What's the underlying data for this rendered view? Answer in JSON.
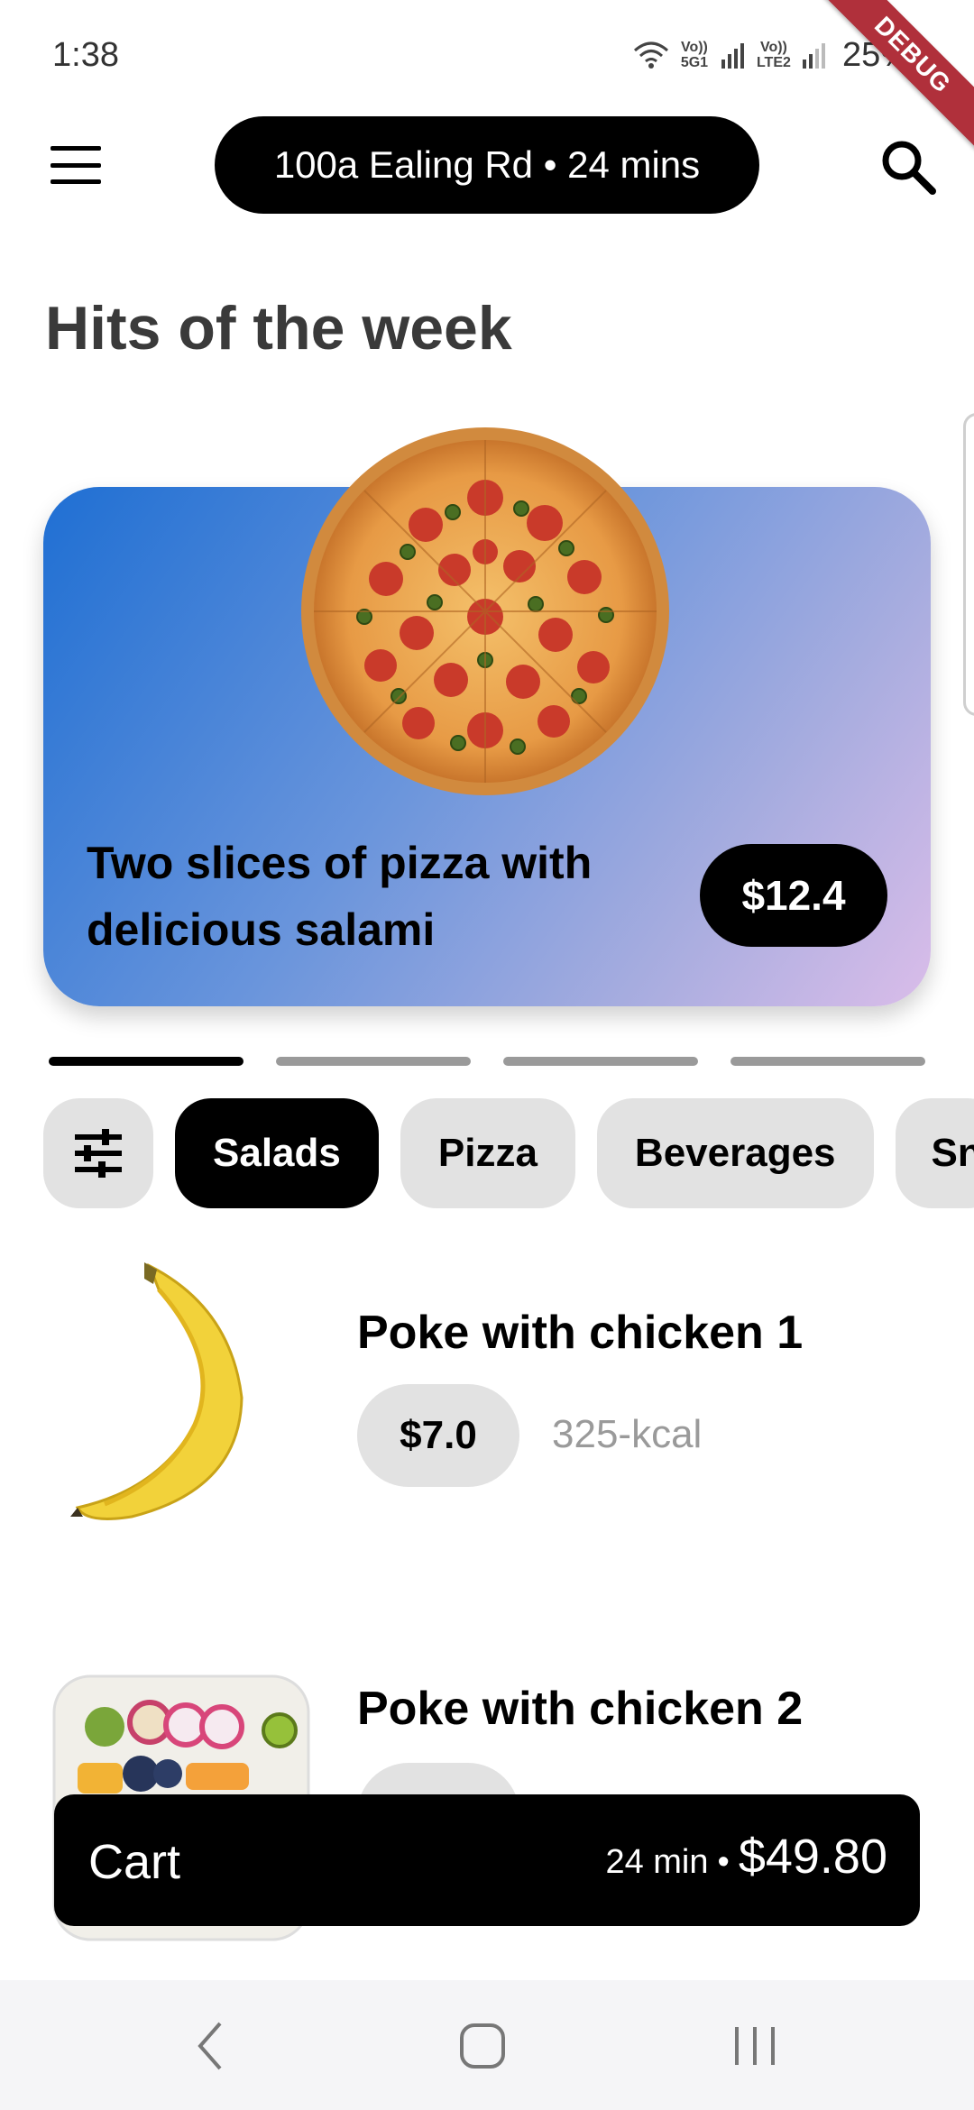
{
  "status_bar": {
    "time": "1:38",
    "signal_1_label": "Vo)) 5G1",
    "signal_2_label": "Vo)) LTE2",
    "battery": "25%",
    "debug_banner": "DEBUG"
  },
  "app_bar": {
    "location_label": "100a Ealing Rd • 24 mins",
    "menu_icon": "menu-icon",
    "search_icon": "search-icon"
  },
  "section_title": "Hits of the week",
  "hero": {
    "title": "Two slices of pizza with delicious salami",
    "price": "$12.4",
    "image": "pizza",
    "gradient_colors": [
      "#1f6fd3",
      "#6a95dc",
      "#a6acdf",
      "#dabde9"
    ]
  },
  "carousel": {
    "page_count": 4,
    "active_index": 0
  },
  "categories": {
    "filter_icon": "filter-sliders-icon",
    "items": [
      {
        "label": "Salads",
        "active": true
      },
      {
        "label": "Pizza",
        "active": false
      },
      {
        "label": "Beverages",
        "active": false
      },
      {
        "label": "Sn",
        "active": false
      }
    ]
  },
  "products": [
    {
      "name": "Poke with chicken 1",
      "price": "$7.0",
      "kcal": "325-kcal",
      "image": "banana"
    },
    {
      "name": "Poke with chicken 2",
      "price": "",
      "kcal": "",
      "image": "salad-bowl"
    }
  ],
  "cart": {
    "label": "Cart",
    "time": "24 min",
    "separator": "•",
    "total": "$49.80"
  },
  "nav_bar": {
    "back_icon": "back-icon",
    "home_icon": "home-icon",
    "recents_icon": "recents-icon"
  }
}
